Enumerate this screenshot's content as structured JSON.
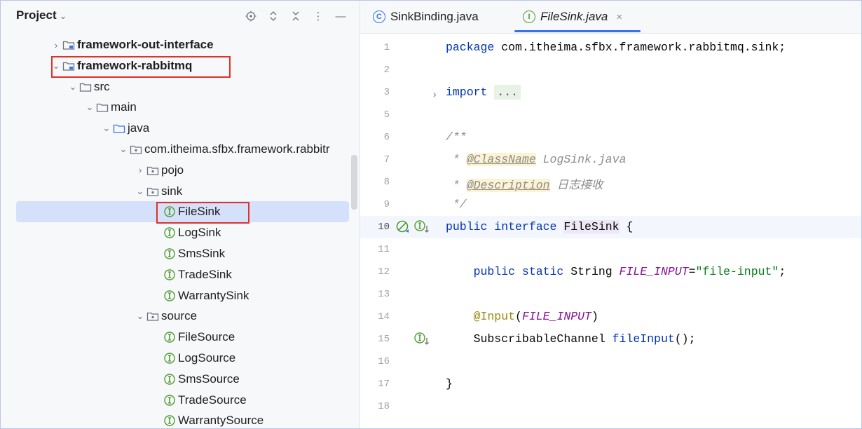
{
  "project": {
    "title": "Project",
    "tree": [
      {
        "label": "framework-out-interface",
        "icon": "module-folder-icon",
        "arrow": "›",
        "bold": true
      },
      {
        "label": "framework-rabbitmq",
        "icon": "module-folder-icon",
        "arrow": "⌄",
        "bold": true
      },
      {
        "label": "src",
        "icon": "folder-icon",
        "arrow": "⌄"
      },
      {
        "label": "main",
        "icon": "folder-icon",
        "arrow": "⌄"
      },
      {
        "label": "java",
        "icon": "source-folder-icon",
        "arrow": "⌄"
      },
      {
        "label": "com.itheima.sfbx.framework.rabbitr",
        "icon": "package-icon",
        "arrow": "⌄"
      },
      {
        "label": "pojo",
        "icon": "package-icon",
        "arrow": "›"
      },
      {
        "label": "sink",
        "icon": "package-icon",
        "arrow": "⌄"
      },
      {
        "label": "FileSink",
        "icon": "interface-icon"
      },
      {
        "label": "LogSink",
        "icon": "interface-icon"
      },
      {
        "label": "SmsSink",
        "icon": "interface-icon"
      },
      {
        "label": "TradeSink",
        "icon": "interface-icon"
      },
      {
        "label": "WarrantySink",
        "icon": "interface-icon"
      },
      {
        "label": "source",
        "icon": "package-icon",
        "arrow": "⌄"
      },
      {
        "label": "FileSource",
        "icon": "interface-icon"
      },
      {
        "label": "LogSource",
        "icon": "interface-icon"
      },
      {
        "label": "SmsSource",
        "icon": "interface-icon"
      },
      {
        "label": "TradeSource",
        "icon": "interface-icon"
      },
      {
        "label": "WarrantySource",
        "icon": "interface-icon"
      }
    ]
  },
  "tabs": [
    {
      "label": "SinkBinding.java",
      "icon": "class-icon"
    },
    {
      "label": "FileSink.java",
      "icon": "interface-icon",
      "active": true
    }
  ],
  "editor": {
    "lines": [
      {
        "n": "1",
        "parts": [
          [
            "kw",
            "package "
          ],
          [
            "",
            "com.itheima.sfbx.framework.rabbitmq.sink;"
          ]
        ]
      },
      {
        "n": "2",
        "parts": []
      },
      {
        "n": "3",
        "parts": [
          [
            "kw",
            "import "
          ],
          [
            "fold",
            "..."
          ]
        ]
      },
      {
        "n": "5",
        "parts": []
      },
      {
        "n": "6",
        "parts": [
          [
            "cm",
            "/**"
          ]
        ]
      },
      {
        "n": "7",
        "parts": [
          [
            "cm",
            " * "
          ],
          [
            "tag",
            "@ClassName"
          ],
          [
            "cm",
            " LogSink.java"
          ]
        ]
      },
      {
        "n": "8",
        "parts": [
          [
            "cm",
            " * "
          ],
          [
            "tag",
            "@Description"
          ],
          [
            "cm",
            " 日志接收"
          ]
        ]
      },
      {
        "n": "9",
        "parts": [
          [
            "cm",
            " */"
          ]
        ]
      },
      {
        "n": "10",
        "parts": [
          [
            "kw",
            "public interface "
          ],
          [
            "sel",
            "FileSink"
          ],
          [
            "",
            " {"
          ]
        ]
      },
      {
        "n": "11",
        "parts": []
      },
      {
        "n": "12",
        "parts": [
          [
            "kw",
            "    public static "
          ],
          [
            "",
            "String "
          ],
          [
            "const",
            "FILE_INPUT"
          ],
          [
            "",
            "="
          ],
          [
            "str",
            "\"file-input\""
          ],
          [
            "",
            ";"
          ]
        ]
      },
      {
        "n": "13",
        "parts": []
      },
      {
        "n": "14",
        "parts": [
          [
            "anno",
            "    @Input"
          ],
          [
            "",
            "("
          ],
          [
            "const",
            "FILE_INPUT"
          ],
          [
            "",
            ")"
          ]
        ]
      },
      {
        "n": "15",
        "parts": [
          [
            "",
            "    SubscribableChannel "
          ],
          [
            "kw",
            "fileInput"
          ],
          [
            "",
            "();"
          ]
        ]
      },
      {
        "n": "16",
        "parts": []
      },
      {
        "n": "17",
        "parts": [
          [
            "",
            "}"
          ]
        ]
      },
      {
        "n": "18",
        "parts": []
      }
    ]
  },
  "colors": {
    "accent": "#3574f0",
    "highlight_box": "#e0312a",
    "selected_row": "#d5e1fb"
  }
}
